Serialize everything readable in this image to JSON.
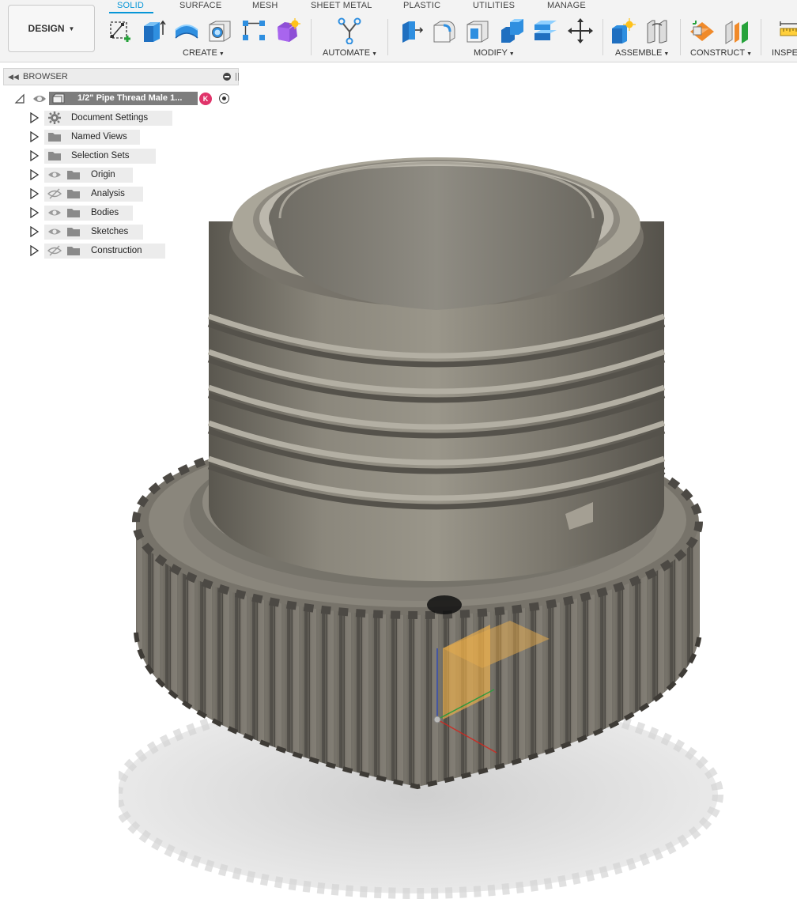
{
  "workspace": {
    "label": "DESIGN"
  },
  "tabs": [
    {
      "label": "SOLID",
      "active": true
    },
    {
      "label": "SURFACE",
      "active": false
    },
    {
      "label": "MESH",
      "active": false
    },
    {
      "label": "SHEET METAL",
      "active": false
    },
    {
      "label": "PLASTIC",
      "active": false
    },
    {
      "label": "UTILITIES",
      "active": false
    },
    {
      "label": "MANAGE",
      "active": false
    }
  ],
  "groups": {
    "create": "CREATE",
    "automate": "AUTOMATE",
    "modify": "MODIFY",
    "assemble": "ASSEMBLE",
    "construct": "CONSTRUCT",
    "inspect": "INSPEC"
  },
  "tools": {
    "create": [
      "create-sketch-icon",
      "extrude-icon",
      "revolve-icon",
      "hole-icon",
      "pattern-icon",
      "create-form-icon"
    ],
    "automate": [
      "automate-icon"
    ],
    "modify": [
      "press-pull-icon",
      "fillet-icon",
      "shell-icon",
      "combine-icon",
      "offset-face-icon",
      "move-icon"
    ],
    "assemble": [
      "new-component-icon",
      "joint-icon"
    ],
    "construct": [
      "offset-plane-icon",
      "midplane-icon"
    ],
    "inspect": [
      "measure-icon"
    ]
  },
  "browser": {
    "title": "BROWSER",
    "root": {
      "label": "1/2\" Pipe Thread Male 1...",
      "badge": "K"
    },
    "items": [
      {
        "label": "Document Settings",
        "icon": "gear-icon",
        "eye": "none"
      },
      {
        "label": "Named Views",
        "icon": "folder-icon",
        "eye": "none"
      },
      {
        "label": "Selection Sets",
        "icon": "folder-icon",
        "eye": "none"
      },
      {
        "label": "Origin",
        "icon": "folder-icon",
        "eye": "visible"
      },
      {
        "label": "Analysis",
        "icon": "folder-icon",
        "eye": "hidden"
      },
      {
        "label": "Bodies",
        "icon": "folder-icon",
        "eye": "visible"
      },
      {
        "label": "Sketches",
        "icon": "folder-icon",
        "eye": "visible"
      },
      {
        "label": "Construction",
        "icon": "folder-icon",
        "eye": "hidden"
      }
    ]
  },
  "colors": {
    "accent": "#0696d7",
    "body_metal": "#7e7a72",
    "shadow": "#d9d9d9",
    "origin_plane": "#f2b24a"
  }
}
